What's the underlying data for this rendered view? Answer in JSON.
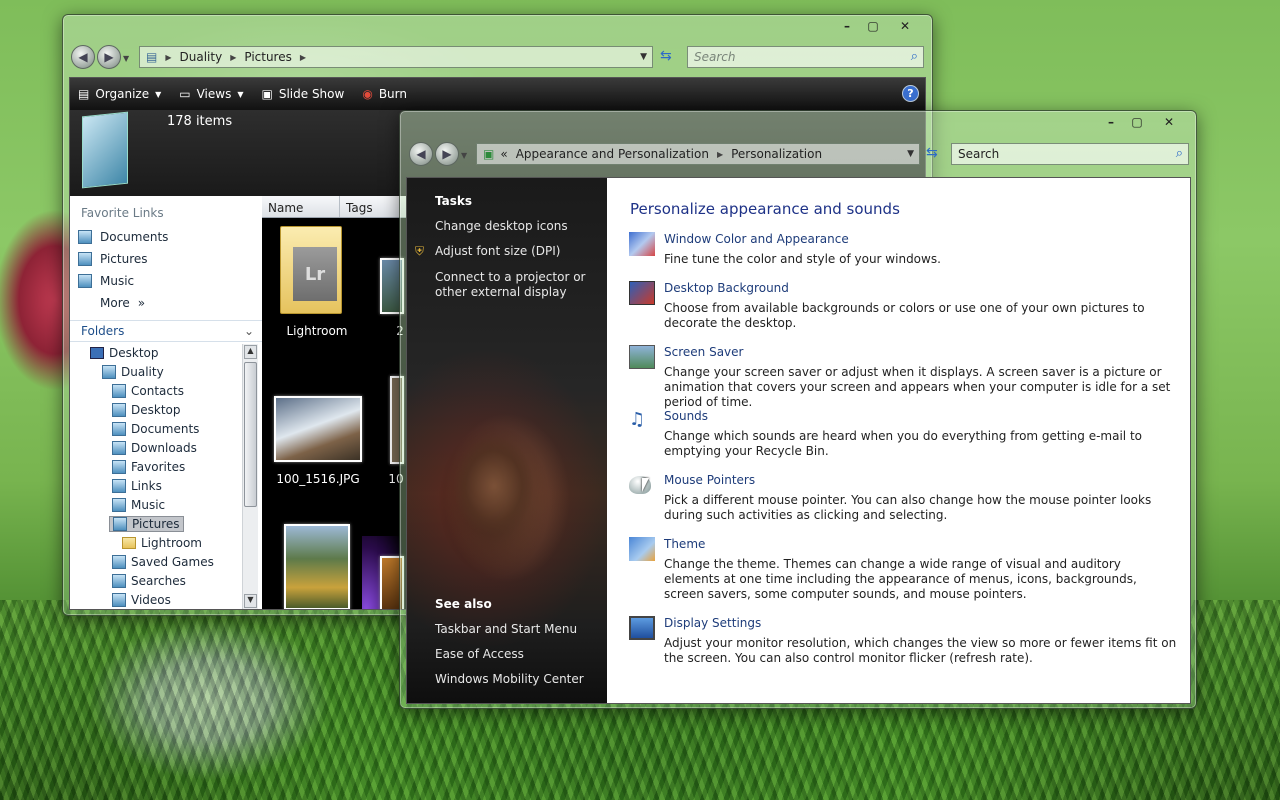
{
  "explorer": {
    "breadcrumb": [
      "Duality",
      "Pictures"
    ],
    "search_placeholder": "Search",
    "toolbar": {
      "organize": "Organize",
      "views": "Views",
      "slideshow": "Slide Show",
      "burn": "Burn"
    },
    "item_count": "178 items",
    "favorites_header": "Favorite Links",
    "favorites": [
      "Documents",
      "Pictures",
      "Music"
    ],
    "more_label": "More",
    "folders_header": "Folders",
    "tree": [
      "Desktop",
      "Duality",
      "Contacts",
      "Desktop",
      "Documents",
      "Downloads",
      "Favorites",
      "Links",
      "Music",
      "Pictures",
      "Lightroom",
      "Saved Games",
      "Searches",
      "Videos"
    ],
    "columns": [
      "Name",
      "Tags"
    ],
    "files": [
      {
        "label": "Lightroom",
        "tag": "Lr"
      },
      {
        "label": "100_1516.JPG"
      }
    ],
    "partial_labels": [
      "2",
      "10"
    ]
  },
  "personalization": {
    "breadcrumb_prefix": "«",
    "breadcrumb": [
      "Appearance and Personalization",
      "Personalization"
    ],
    "search_placeholder": "Search",
    "tasks_header": "Tasks",
    "tasks": [
      "Change desktop icons",
      "Adjust font size (DPI)",
      "Connect to a projector or other external display"
    ],
    "see_also_header": "See also",
    "see_also": [
      "Taskbar and Start Menu",
      "Ease of Access",
      "Windows Mobility Center"
    ],
    "heading": "Personalize appearance and sounds",
    "items": [
      {
        "title": "Window Color and Appearance",
        "desc": "Fine tune the color and style of your windows.",
        "icon": "window-color-icon"
      },
      {
        "title": "Desktop Background",
        "desc": "Choose from available backgrounds or colors or use one of your own pictures to decorate the desktop.",
        "icon": "desktop-background-icon"
      },
      {
        "title": "Screen Saver",
        "desc": "Change your screen saver or adjust when it displays. A screen saver is a picture or animation that covers your screen and appears when your computer is idle for a set period of time.",
        "icon": "screen-saver-icon"
      },
      {
        "title": "Sounds",
        "desc": "Change which sounds are heard when you do everything from getting e-mail to emptying your Recycle Bin.",
        "icon": "sounds-icon"
      },
      {
        "title": "Mouse Pointers",
        "desc": "Pick a different mouse pointer. You can also change how the mouse pointer looks during such activities as clicking and selecting.",
        "icon": "mouse-pointer-icon"
      },
      {
        "title": "Theme",
        "desc": "Change the theme. Themes can change a wide range of visual and auditory elements at one time including the appearance of menus, icons, backgrounds, screen savers, some computer sounds, and mouse pointers.",
        "icon": "theme-icon"
      },
      {
        "title": "Display Settings",
        "desc": "Adjust your monitor resolution, which changes the view so more or fewer items fit on the screen. You can also control monitor flicker (refresh rate).",
        "icon": "display-settings-icon"
      }
    ]
  }
}
